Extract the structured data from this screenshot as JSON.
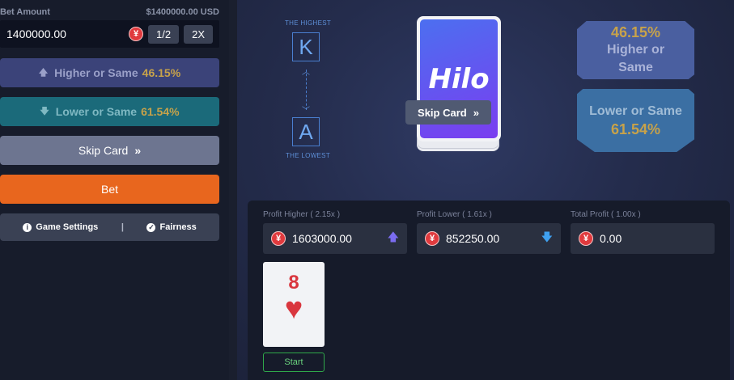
{
  "bet": {
    "label": "Bet Amount",
    "balance": "$1400000.00 USD",
    "value": "1400000.00",
    "currency_icon": "yuan-coin-icon",
    "half_label": "1/2",
    "double_label": "2X"
  },
  "controls": {
    "higher_label": "Higher or Same",
    "higher_pct": "46.15%",
    "lower_label": "Lower or Same",
    "lower_pct": "61.54%",
    "skip_label": "Skip Card",
    "bet_label": "Bet",
    "settings_label": "Game Settings",
    "separator": "|",
    "fairness_label": "Fairness"
  },
  "ranks": {
    "highest_label": "THE HIGHEST",
    "highest_rank": "K",
    "lowest_label": "THE LOWEST",
    "lowest_rank": "A"
  },
  "deck": {
    "logo_text": "Hilo",
    "skip_label": "Skip Card"
  },
  "odds": {
    "higher_pct": "46.15%",
    "higher_label": "Higher or Same",
    "lower_label": "Lower or Same",
    "lower_pct": "61.54%"
  },
  "profits": [
    {
      "label": "Profit Higher ( 2.15x )",
      "value": "1603000.00",
      "arrow": "arrow-up-icon"
    },
    {
      "label": "Profit Lower ( 1.61x )",
      "value": "852250.00",
      "arrow": "arrow-down-icon"
    },
    {
      "label": "Total Profit ( 1.00x )",
      "value": "0.00"
    }
  ],
  "current_card": {
    "rank": "8",
    "suit": "hearts",
    "suit_glyph": "♥"
  },
  "start_label": "Start",
  "colors": {
    "accent_orange": "#e8661e",
    "higher_btn": "#3b4379",
    "lower_btn": "#1b6a7a",
    "gold": "#c7a24a",
    "card_red": "#d9363e"
  }
}
